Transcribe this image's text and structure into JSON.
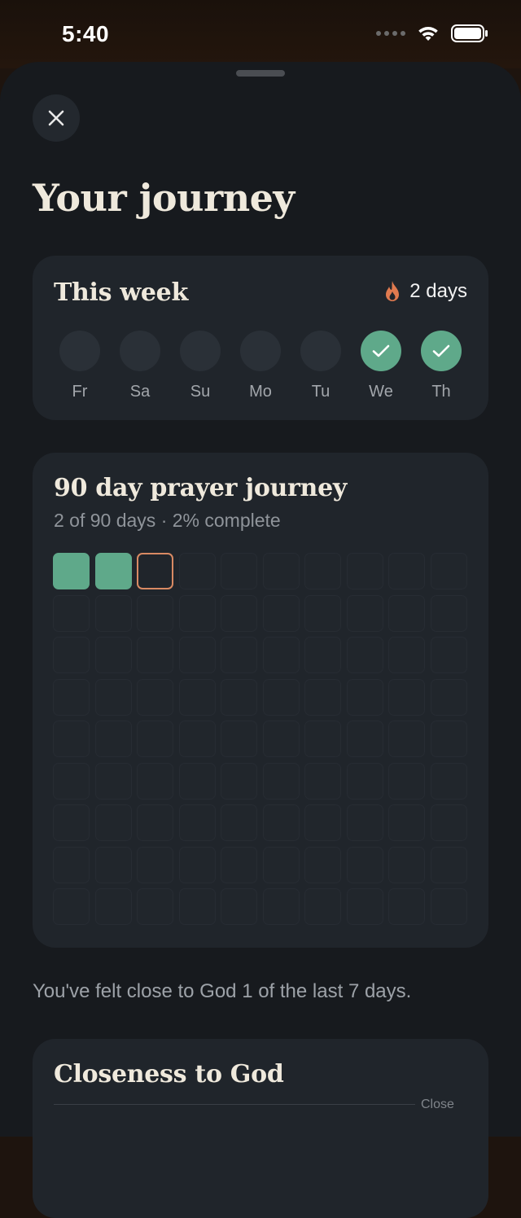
{
  "status": {
    "time": "5:40"
  },
  "header": {
    "title": "Your journey"
  },
  "week": {
    "title": "This week",
    "streak_label": "2 days",
    "days": [
      {
        "label": "Fr",
        "done": false
      },
      {
        "label": "Sa",
        "done": false
      },
      {
        "label": "Su",
        "done": false
      },
      {
        "label": "Mo",
        "done": false
      },
      {
        "label": "Tu",
        "done": false
      },
      {
        "label": "We",
        "done": true
      },
      {
        "label": "Th",
        "done": true
      }
    ]
  },
  "journey": {
    "title": "90 day prayer journey",
    "subtitle": "2 of 90 days · 2% complete",
    "total_days": 90,
    "completed_days": 2,
    "today_index": 3
  },
  "insight": {
    "text": "You've felt close to God 1 of the last 7 days."
  },
  "closeness": {
    "title": "Closeness to God",
    "axis_label": "Close"
  },
  "colors": {
    "accent_green": "#5fa98a",
    "accent_orange": "#d98a63",
    "card_bg": "#20252b",
    "sheet_bg": "#171a1e"
  }
}
